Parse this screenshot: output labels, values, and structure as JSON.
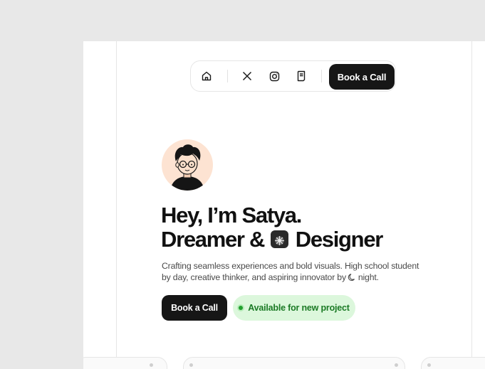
{
  "nav": {
    "icons": [
      "home-icon",
      "x-logo-icon",
      "instagram-icon",
      "notebook-icon"
    ],
    "cta_label": "Book a Call"
  },
  "hero": {
    "title_line1": "Hey, I’m Satya.",
    "title_line2_a": "Dreamer &",
    "title_line2_b": "Designer",
    "description_a": "Crafting seamless experiences and bold visuals. High school student by day, creative thinker, and aspiring innovator by",
    "description_b": "night.",
    "primary_button": "Book a Call",
    "status_label": "Available for new project"
  },
  "colors": {
    "background": "#e8e8e8",
    "dark": "#161616",
    "status_bg": "#dcf7dc",
    "status_text": "#1b7a25"
  }
}
